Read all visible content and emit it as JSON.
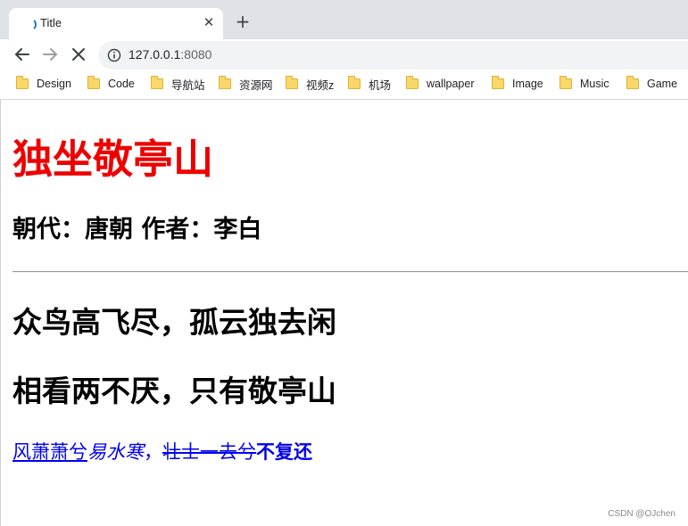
{
  "browser": {
    "tab": {
      "title": "Title"
    },
    "url": {
      "host": "127.0.0.1",
      "port": ":8080"
    },
    "bookmarks": [
      {
        "label": "Design"
      },
      {
        "label": "Code"
      },
      {
        "label": "导航站"
      },
      {
        "label": "资源网"
      },
      {
        "label": "视频z"
      },
      {
        "label": "机场"
      },
      {
        "label": "wallpaper"
      },
      {
        "label": "Image"
      },
      {
        "label": "Music"
      },
      {
        "label": "Game"
      }
    ]
  },
  "page": {
    "title": "独坐敬亭山",
    "meta": "朝代：唐朝  作者：李白",
    "verse1": "众鸟高飞尽，孤云独去闲",
    "verse2": "相看两不厌，只有敬亭山",
    "quote": {
      "part_underline": "风萧萧兮",
      "part_italic": "易水寒",
      "comma": "，",
      "part_strike": "壮士一去兮",
      "part_bold": "不复还"
    }
  },
  "watermark": "CSDN @OJchen",
  "colors": {
    "title": "#ee0000",
    "link": "#0000ee",
    "tab_strip": "#dee1e6",
    "omnibox": "#f1f3f4",
    "loading_spinner": "#1a73e8"
  },
  "icons": {
    "back": "arrow-left-icon",
    "forward": "arrow-right-icon",
    "stop": "close-icon",
    "site_info": "info-icon",
    "bookmark": "folder-icon"
  }
}
